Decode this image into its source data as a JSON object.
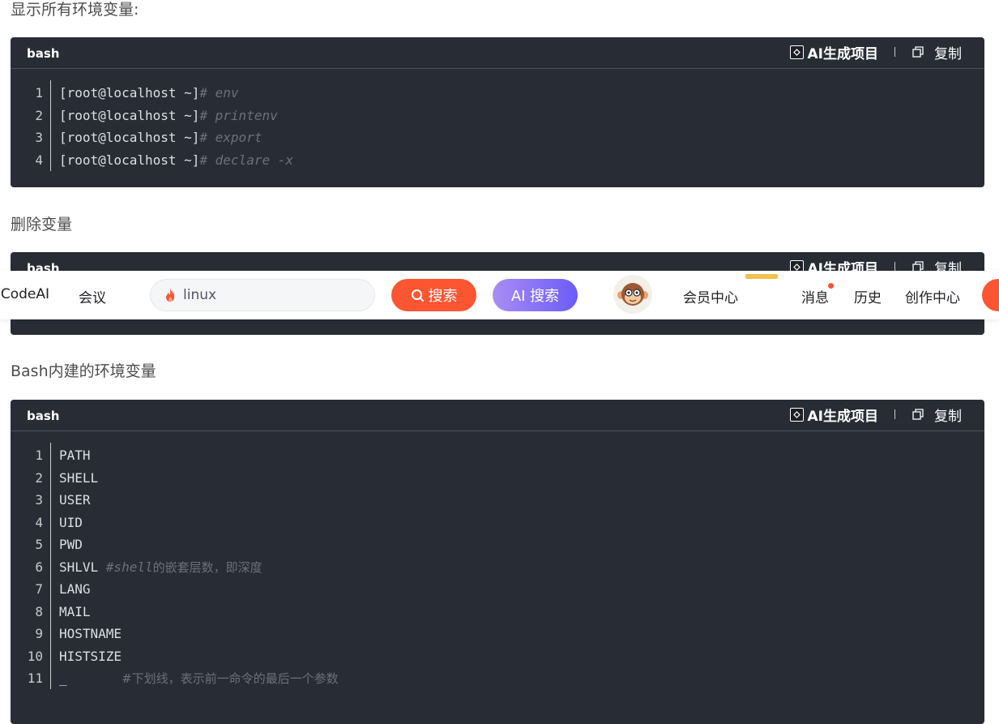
{
  "sections": [
    {
      "heading": "显示所有环境变量:",
      "lang": "bash",
      "ai_label": "AI生成项目",
      "copy_label": "复制",
      "lines": [
        {
          "n": "1",
          "code": "[root@localhost ~]",
          "comment": "# env"
        },
        {
          "n": "2",
          "code": "[root@localhost ~]",
          "comment": "# printenv"
        },
        {
          "n": "3",
          "code": "[root@localhost ~]",
          "comment": "# export"
        },
        {
          "n": "4",
          "code": "[root@localhost ~]",
          "comment": "# declare -x"
        }
      ]
    },
    {
      "heading": "删除变量",
      "lang": "bash",
      "ai_label": "AI生成项目",
      "copy_label": "复制",
      "lines": []
    },
    {
      "heading": "Bash内建的环境变量",
      "lang": "bash",
      "ai_label": "AI生成项目",
      "copy_label": "复制",
      "lines": [
        {
          "n": "1",
          "code": "PATH",
          "comment": ""
        },
        {
          "n": "2",
          "code": "SHELL",
          "comment": ""
        },
        {
          "n": "3",
          "code": "USER",
          "comment": ""
        },
        {
          "n": "4",
          "code": "UID",
          "comment": ""
        },
        {
          "n": "5",
          "code": "PWD",
          "comment": ""
        },
        {
          "n": "6",
          "code": "SHLVL ",
          "comment": "#shell",
          "comment2": "的嵌套层数，即深度"
        },
        {
          "n": "7",
          "code": "LANG",
          "comment": ""
        },
        {
          "n": "8",
          "code": "MAIL",
          "comment": ""
        },
        {
          "n": "9",
          "code": "HOSTNAME",
          "comment": ""
        },
        {
          "n": "10",
          "code": "HISTSIZE",
          "comment": ""
        },
        {
          "n": "11",
          "code": "_       ",
          "comment": "",
          "comment2": "#下划线，表示前一命令的最后一个参数"
        }
      ]
    }
  ],
  "toolbar": {
    "brand_partial": "sCodeAI",
    "meeting": "会议",
    "search_value": "linux",
    "search_button": "搜索",
    "ai_search_button": "AI 搜索",
    "member_center": "会员中心",
    "messages": "消息",
    "history": "历史",
    "creator_center": "创作中心"
  },
  "colors": {
    "accent": "#fc5531",
    "code_bg": "#282c34",
    "ai_gradient_start": "#a98cf4",
    "ai_gradient_end": "#6b5cf7"
  }
}
